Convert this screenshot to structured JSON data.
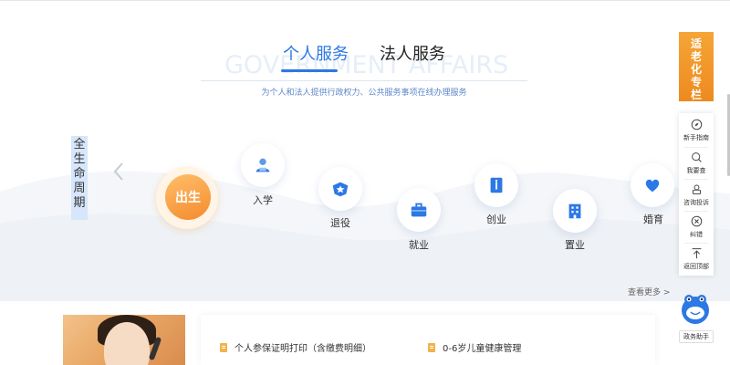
{
  "header": {
    "watermark": "GOVERNMENT AFFAIRS",
    "tabs": [
      {
        "label": "个人服务",
        "active": true
      },
      {
        "label": "法人服务",
        "active": false
      }
    ],
    "subtitle": "为个人和法人提供行政权力、公共服务事项在线办理服务"
  },
  "lifecycle": {
    "label_chars": [
      "全",
      "生",
      "命",
      "周",
      "期"
    ],
    "active": "出生",
    "stages": [
      {
        "label": "入学",
        "icon": "student-icon"
      },
      {
        "label": "退役",
        "icon": "badge-icon"
      },
      {
        "label": "就业",
        "icon": "briefcase-icon"
      },
      {
        "label": "创业",
        "icon": "startup-icon"
      },
      {
        "label": "置业",
        "icon": "building-icon"
      },
      {
        "label": "婚育",
        "icon": "heart-icon"
      }
    ]
  },
  "more": {
    "label": "查看更多 >"
  },
  "services": [
    {
      "label": "个人参保证明打印（含缴费明细）"
    },
    {
      "label": "0-6岁儿童健康管理"
    }
  ],
  "sidebar": {
    "elder_banner": "适老化专栏",
    "elder_banner_chars": [
      "适",
      "老",
      "化",
      "专",
      "栏"
    ],
    "items": [
      {
        "label": "新手指南",
        "icon": "compass-icon"
      },
      {
        "label": "我要查",
        "icon": "search-icon"
      },
      {
        "label": "咨询投诉",
        "icon": "consult-icon"
      },
      {
        "label": "纠错",
        "icon": "error-icon"
      },
      {
        "label": "返回顶部",
        "icon": "back-to-top-icon"
      }
    ],
    "assistant_label": "政务助手"
  },
  "colors": {
    "accent": "#2c78e4",
    "active_stage": "#f58a2d",
    "elder_banner": "#f09425"
  }
}
